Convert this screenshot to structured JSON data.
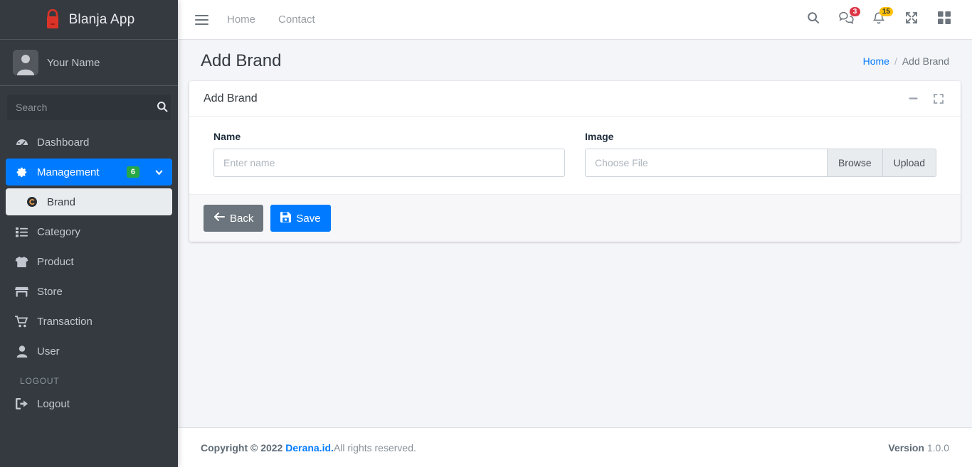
{
  "sidebar": {
    "brand": {
      "title": "Blanja App",
      "logo_icon": "shopping-bag-icon"
    },
    "user": {
      "name": "Your Name",
      "avatar_icon": "user-avatar-icon"
    },
    "search": {
      "placeholder": "Search",
      "value": "",
      "button_icon": "search-icon"
    },
    "items": [
      {
        "label": "Dashboard",
        "icon": "tachometer-icon",
        "state": "normal"
      },
      {
        "label": "Management",
        "icon": "gear-icon",
        "state": "active",
        "badge": "6",
        "chevron": "chevron-down-icon"
      },
      {
        "label": "Brand",
        "icon": "copyright-circle-icon",
        "state": "sub-active"
      },
      {
        "label": "Category",
        "icon": "list-icon",
        "state": "normal"
      },
      {
        "label": "Product",
        "icon": "tshirt-icon",
        "state": "normal"
      },
      {
        "label": "Store",
        "icon": "store-icon",
        "state": "normal"
      },
      {
        "label": "Transaction",
        "icon": "shopping-cart-icon",
        "state": "normal"
      },
      {
        "label": "User",
        "icon": "user-icon",
        "state": "normal"
      }
    ],
    "logout_header": "LOGOUT",
    "logout": {
      "label": "Logout",
      "icon": "sign-out-icon"
    }
  },
  "navbar": {
    "toggle_icon": "hamburger-icon",
    "links": [
      {
        "label": "Home"
      },
      {
        "label": "Contact"
      }
    ],
    "icons": [
      {
        "name": "search-icon",
        "badge": null
      },
      {
        "name": "comments-icon",
        "badge": "3",
        "badge_color": "#dc3545"
      },
      {
        "name": "bell-icon",
        "badge": "15",
        "badge_color": "#ffc107"
      },
      {
        "name": "expand-arrows-icon",
        "badge": null
      },
      {
        "name": "grid-icon",
        "badge": null
      }
    ]
  },
  "page": {
    "title": "Add Brand",
    "breadcrumb": {
      "home": "Home",
      "separator": "/",
      "current": "Add Brand"
    }
  },
  "card": {
    "title": "Add Brand",
    "tools": [
      {
        "name": "minimize-icon"
      },
      {
        "name": "maximize-icon"
      }
    ],
    "form": {
      "name_label": "Name",
      "name_placeholder": "Enter name",
      "name_value": "",
      "image_label": "Image",
      "image_placeholder": "Choose File",
      "image_value": "",
      "browse_label": "Browse",
      "upload_label": "Upload"
    },
    "footer": {
      "back_label": "Back",
      "back_icon": "arrow-left-icon",
      "save_label": "Save",
      "save_icon": "floppy-disk-icon"
    }
  },
  "footer": {
    "copyright": "Copyright © 2022",
    "link": "Derana.id.",
    "rights": "All rights reserved.",
    "version_label": "Version",
    "version_number": "1.0.0"
  },
  "colors": {
    "sidebar_bg": "#343a40",
    "accent_blue": "#007bff",
    "badge_green": "#28a745",
    "badge_red": "#dc3545",
    "badge_yellow": "#ffc107",
    "logo_red": "#dc3328"
  }
}
